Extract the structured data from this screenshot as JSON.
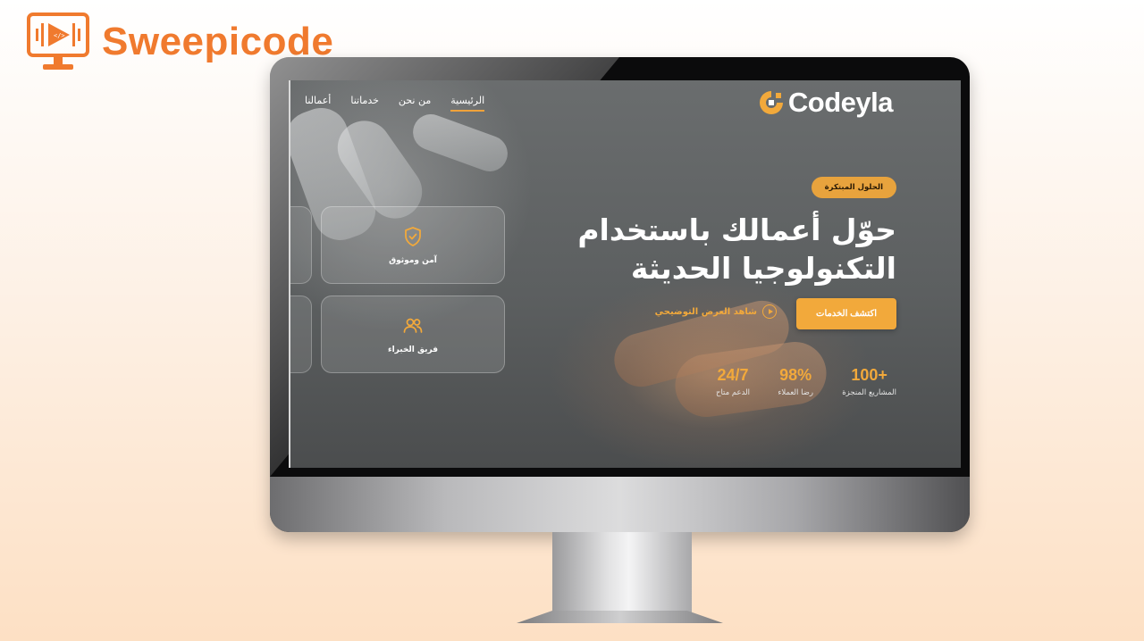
{
  "brand": {
    "name": "Sweepicode",
    "icon": "monitor-code-icon",
    "color": "#f07a2e"
  },
  "site": {
    "logo_text": "Codeyla",
    "logo_icon": "codeyla-logo-icon",
    "accent": "#f2a93b",
    "nav": {
      "items": [
        {
          "label": "أعمالنا"
        },
        {
          "label": "خدماتنا"
        },
        {
          "label": "من نحن"
        },
        {
          "label": "الرئيسية",
          "active": true
        }
      ]
    },
    "hero": {
      "badge": "الحلول المبتكرة",
      "headline_line1": "حوّل أعمالك باستخدام",
      "headline_line2": "التكنولوجيا الحديثة",
      "cta_label": "اكتشف الخدمات",
      "demo_label": "شاهد العرض التوضيحي"
    },
    "stats": [
      {
        "value": "+100",
        "label": "المشاريع المنجزة"
      },
      {
        "value": "98%",
        "label": "رضا العملاء"
      },
      {
        "value": "24/7",
        "label": "الدعم متاح"
      }
    ],
    "cards": [
      {
        "label": "آمن وموثوق",
        "icon": "shield-check-icon"
      },
      {
        "label": "فريق الخبراء",
        "icon": "users-icon"
      }
    ]
  }
}
